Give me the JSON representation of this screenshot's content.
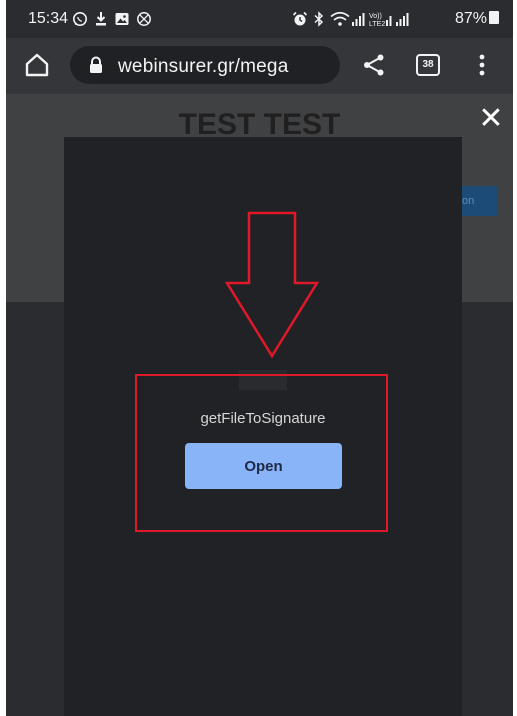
{
  "status_bar": {
    "time": "15:34",
    "battery": "87%",
    "left_icons": [
      "whatsapp-icon",
      "download-icon",
      "gallery-icon",
      "blocked-icon"
    ],
    "right_icons": [
      "alarm-icon",
      "bluetooth-icon",
      "wifi-icon",
      "signal-icon",
      "volte-signal-icon",
      "signal-icon"
    ]
  },
  "browser": {
    "url": "webinsurer.gr/mega",
    "tab_count": "38"
  },
  "page": {
    "title": "TEST TEST",
    "background_button_label": "on"
  },
  "modal": {
    "document_name": "getFileToSignature",
    "open_label": "Open",
    "close_symbol": "✕"
  },
  "colors": {
    "annotation": "#e0182a",
    "open_button": "#8ab4f8",
    "modal_background": "#212226"
  }
}
